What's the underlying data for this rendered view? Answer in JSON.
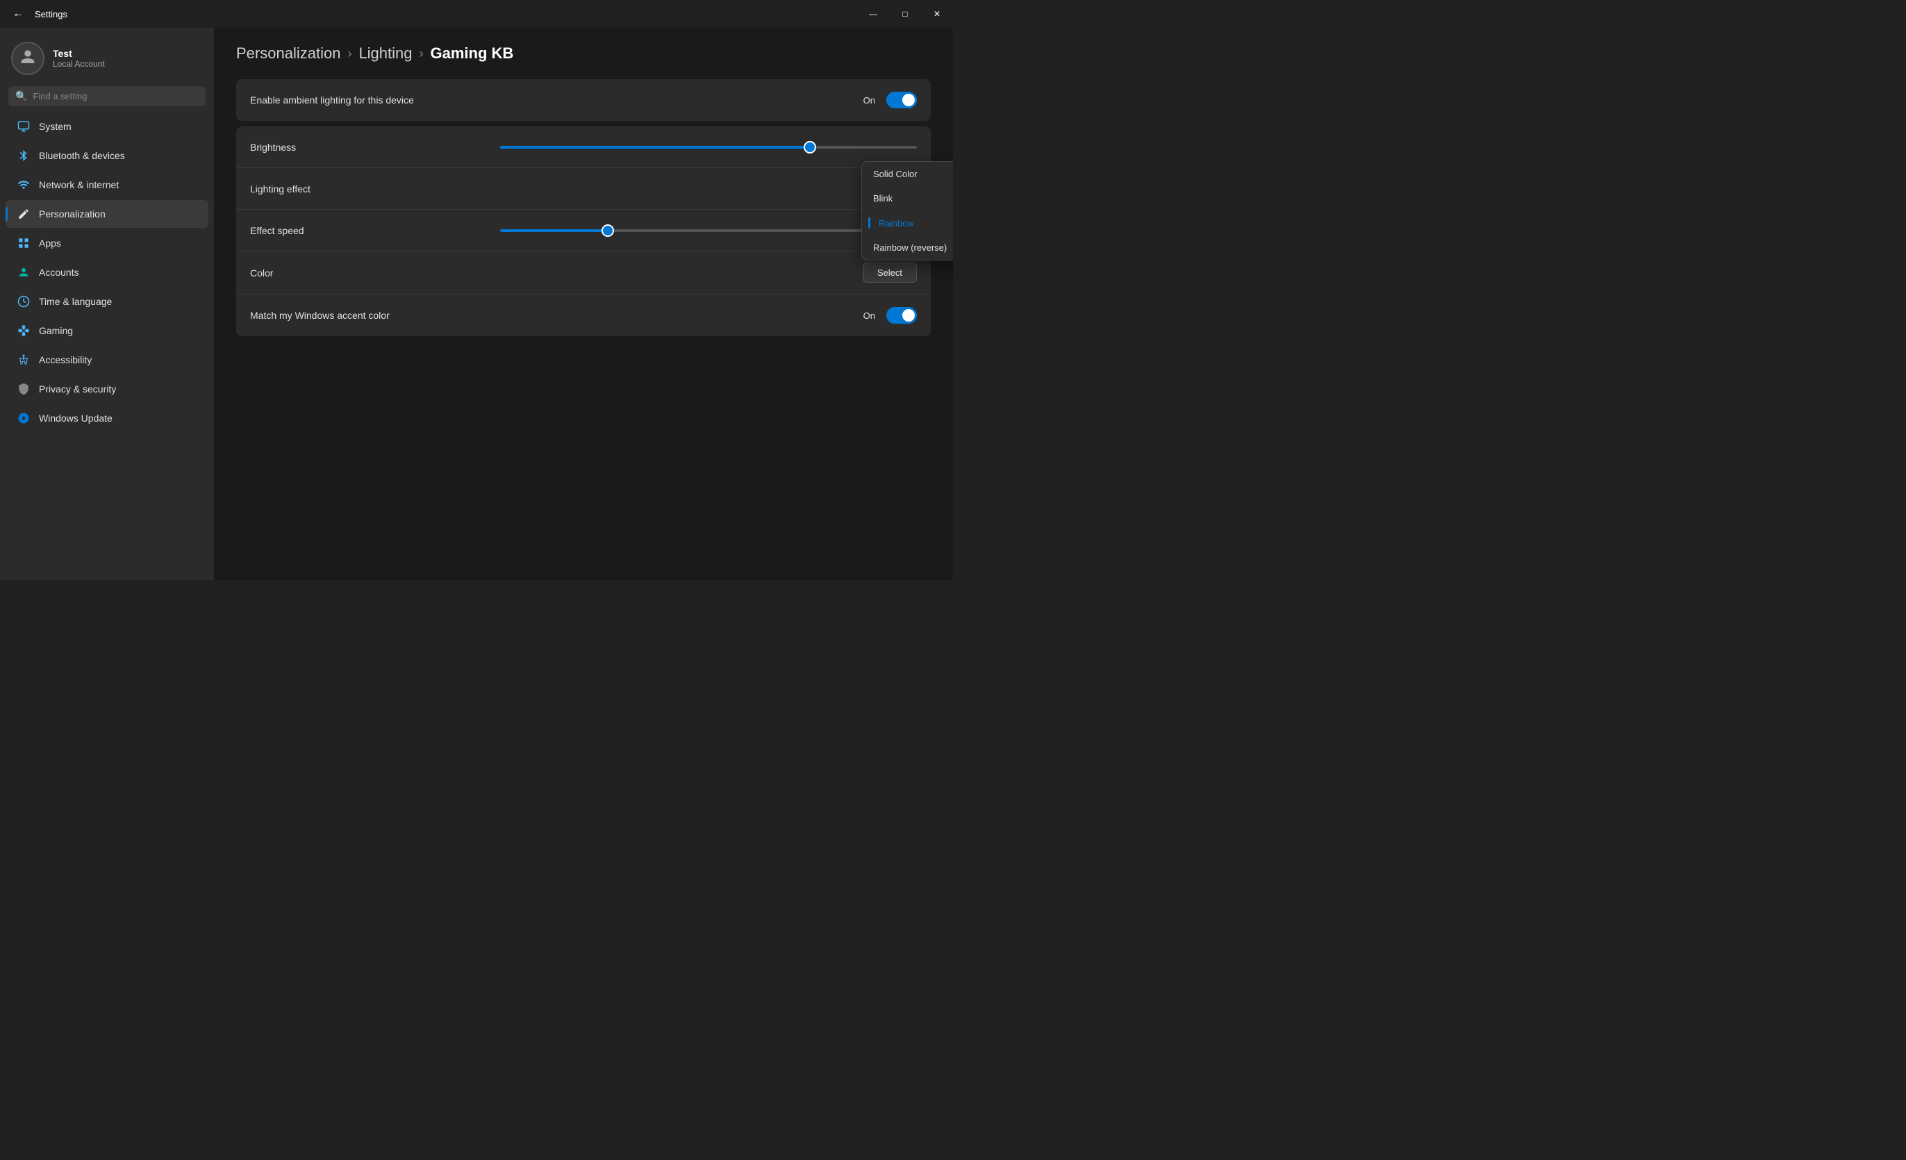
{
  "window": {
    "title": "Settings",
    "controls": {
      "minimize": "—",
      "maximize": "□",
      "close": "✕"
    }
  },
  "sidebar": {
    "user": {
      "name": "Test",
      "subtitle": "Local Account"
    },
    "search": {
      "placeholder": "Find a setting"
    },
    "items": [
      {
        "id": "system",
        "label": "System",
        "icon": "monitor"
      },
      {
        "id": "bluetooth",
        "label": "Bluetooth & devices",
        "icon": "bluetooth"
      },
      {
        "id": "network",
        "label": "Network & internet",
        "icon": "network"
      },
      {
        "id": "personalization",
        "label": "Personalization",
        "icon": "personalization",
        "active": true
      },
      {
        "id": "apps",
        "label": "Apps",
        "icon": "apps"
      },
      {
        "id": "accounts",
        "label": "Accounts",
        "icon": "accounts"
      },
      {
        "id": "time",
        "label": "Time & language",
        "icon": "time"
      },
      {
        "id": "gaming",
        "label": "Gaming",
        "icon": "gaming"
      },
      {
        "id": "accessibility",
        "label": "Accessibility",
        "icon": "accessibility"
      },
      {
        "id": "privacy",
        "label": "Privacy & security",
        "icon": "privacy"
      },
      {
        "id": "update",
        "label": "Windows Update",
        "icon": "update"
      }
    ]
  },
  "breadcrumb": {
    "parts": [
      "Personalization",
      "Lighting",
      "Gaming KB"
    ]
  },
  "settings": {
    "ambient_toggle": {
      "label": "Enable ambient lighting for this device",
      "state_label": "On"
    },
    "brightness": {
      "label": "Brightness",
      "value": 75
    },
    "lighting_effect": {
      "label": "Lighting effect",
      "dropdown": {
        "options": [
          {
            "id": "solid",
            "label": "Solid Color",
            "selected": false
          },
          {
            "id": "blink",
            "label": "Blink",
            "selected": false
          },
          {
            "id": "rainbow",
            "label": "Rainbow",
            "selected": true
          },
          {
            "id": "rainbow_reverse",
            "label": "Rainbow (reverse)",
            "selected": false
          }
        ]
      }
    },
    "effect_speed": {
      "label": "Effect speed",
      "value": 25
    },
    "color": {
      "label": "Color",
      "button_label": "Select"
    },
    "accent_match": {
      "label": "Match my Windows accent color",
      "state_label": "On"
    }
  }
}
